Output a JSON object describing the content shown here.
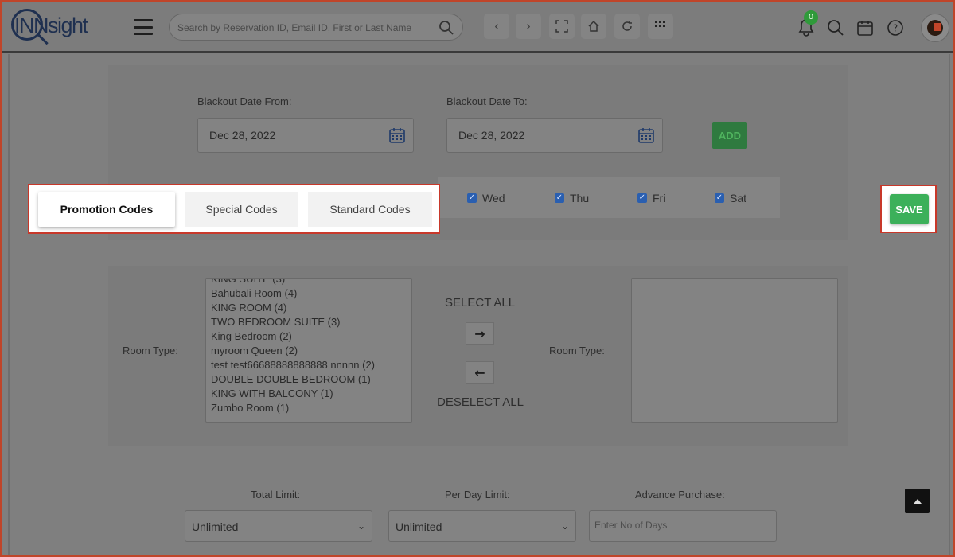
{
  "header": {
    "logo_text": "INNsight",
    "search_placeholder": "Search by Reservation ID, Email ID, First or Last Name",
    "notification_count": "0"
  },
  "blackout": {
    "from_label": "Blackout Date From:",
    "from_value": "Dec 28, 2022",
    "to_label": "Blackout Date To:",
    "to_value": "Dec 28, 2022",
    "add_label": "ADD"
  },
  "days": [
    {
      "label": "Wed",
      "checked": true
    },
    {
      "label": "Thu",
      "checked": true
    },
    {
      "label": "Fri",
      "checked": true
    },
    {
      "label": "Sat",
      "checked": true
    }
  ],
  "tabs": [
    {
      "label": "Promotion Codes",
      "active": true
    },
    {
      "label": "Special Codes",
      "active": false
    },
    {
      "label": "Standard Codes",
      "active": false
    }
  ],
  "save_label": "SAVE",
  "room_type": {
    "left_label": "Room Type:",
    "right_label": "Room Type:",
    "available": [
      "KING SUITE (3)",
      "Bahubali Room (4)",
      "KING ROOM (4)",
      "TWO BEDROOM SUITE (3)",
      "King Bedroom (2)",
      "myroom Queen (2)",
      "test test66688888888888 nnnnn (2)",
      "DOUBLE DOUBLE BEDROOM (1)",
      "KING WITH BALCONY (1)",
      "Zumbo Room (1)"
    ],
    "select_all_label": "SELECT ALL",
    "deselect_all_label": "DESELECT ALL"
  },
  "limits": {
    "total_label": "Total Limit:",
    "total_value": "Unlimited",
    "per_day_label": "Per Day Limit:",
    "per_day_value": "Unlimited",
    "advance_label": "Advance Purchase:",
    "advance_placeholder": "Enter No of Days"
  }
}
